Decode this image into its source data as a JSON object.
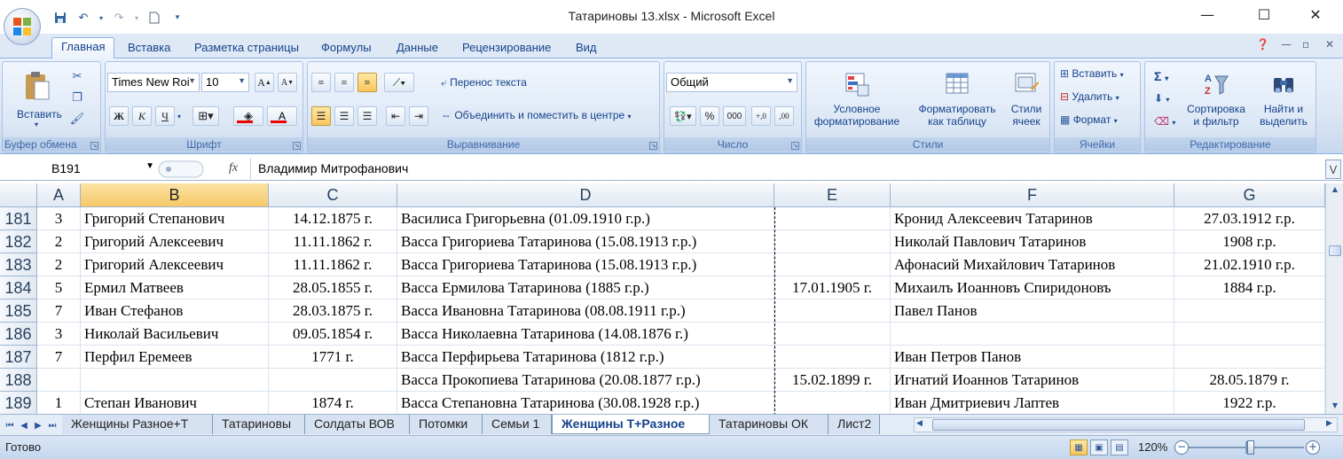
{
  "window": {
    "title": "Татариновы 13.xlsx - Microsoft Excel",
    "minimize_glyph": "—",
    "maximize_glyph": "☐",
    "close_glyph": "✕"
  },
  "ribbon_tabs": [
    "Главная",
    "Вставка",
    "Разметка страницы",
    "Формулы",
    "Данные",
    "Рецензирование",
    "Вид"
  ],
  "ribbon": {
    "clipboard": {
      "paste": "Вставить",
      "label": "Буфер обмена"
    },
    "font": {
      "name": "Times New Roi",
      "size": "10",
      "bold": "Ж",
      "italic": "К",
      "underline": "Ч",
      "label": "Шрифт"
    },
    "alignment": {
      "wrap": "Перенос текста",
      "merge": "Объединить и поместить в центре",
      "label": "Выравнивание"
    },
    "number": {
      "format": "Общий",
      "percent": "%",
      "thousands": "000",
      "label": "Число"
    },
    "styles": {
      "conditional": "Условное",
      "conditional2": "форматирование",
      "as_table": "Форматировать",
      "as_table2": "как таблицу",
      "cell_styles": "Стили",
      "cell_styles2": "ячеек",
      "label": "Стили"
    },
    "cells": {
      "insert": "Вставить",
      "delete": "Удалить",
      "format": "Формат",
      "label": "Ячейки"
    },
    "editing": {
      "sigma": "Σ",
      "sort": "Сортировка",
      "sort2": "и фильтр",
      "find": "Найти и",
      "find2": "выделить",
      "label": "Редактирование"
    }
  },
  "formula_bar": {
    "name_box": "B191",
    "fx": "fx",
    "value": "Владимир Митрофанович"
  },
  "columns": [
    "A",
    "B",
    "C",
    "D",
    "E",
    "F",
    "G"
  ],
  "selected_column": "B",
  "rows": [
    {
      "n": "181",
      "a": "3",
      "b": "Григорий Степанович",
      "c": "14.12.1875 г.",
      "d": "Василиса Григорьевна (01.09.1910 г.р.)",
      "e": "",
      "f": "Кронид Алексеевич Татаринов",
      "g": "27.03.1912 г.р."
    },
    {
      "n": "182",
      "a": "2",
      "b": "Григорий Алексеевич",
      "c": "11.11.1862 г.",
      "d": "Васса Григориева Татаринова (15.08.1913 г.р.)",
      "e": "",
      "f": "Николай Павлович Татаринов",
      "g": "1908 г.р."
    },
    {
      "n": "183",
      "a": "2",
      "b": "Григорий Алексеевич",
      "c": "11.11.1862 г.",
      "d": "Васса Григориева Татаринова (15.08.1913 г.р.)",
      "e": "",
      "f": "Афонасий Михайлович Татаринов",
      "g": "21.02.1910 г.р."
    },
    {
      "n": "184",
      "a": "5",
      "b": "Ермил Матвеев",
      "c": "28.05.1855 г.",
      "d": "Васса Ермилова Татаринова (1885 г.р.)",
      "e": "17.01.1905 г.",
      "f": "Михаилъ Иоанновъ Спиридоновъ",
      "g": "1884 г.р."
    },
    {
      "n": "185",
      "a": "7",
      "b": "Иван Стефанов",
      "c": "28.03.1875 г.",
      "d": "Васса Ивановна Татаринова (08.08.1911 г.р.)",
      "e": "",
      "f": "Павел Панов",
      "g": ""
    },
    {
      "n": "186",
      "a": "3",
      "b": "Николай Васильевич",
      "c": "09.05.1854 г.",
      "d": "Васса Николаевна Татаринова (14.08.1876 г.)",
      "e": "",
      "f": "",
      "g": ""
    },
    {
      "n": "187",
      "a": "7",
      "b": "Перфил Еремеев",
      "c": "1771 г.",
      "d": "Васса Перфирьева Татаринова (1812 г.р.)",
      "e": "",
      "f": "Иван Петров Панов",
      "g": ""
    },
    {
      "n": "188",
      "a": "",
      "b": "",
      "c": "",
      "d": "Васса Прокопиева Татаринова (20.08.1877 г.р.)",
      "e": "15.02.1899 г.",
      "f": "Игнатий Иоаннов Татаринов",
      "g": "28.05.1879 г."
    },
    {
      "n": "189",
      "a": "1",
      "b": "Степан Иванович",
      "c": "1874 г.",
      "d": "Васса Степановна Татаринова (30.08.1928 г.р.)",
      "e": "",
      "f": "Иван Дмитриевич Лаптев",
      "g": "1922 г.р."
    }
  ],
  "sheet_tabs": [
    "Женщины Разное+Т",
    "Татариновы",
    "Солдаты ВОВ",
    "Потомки",
    "Семьи 1",
    "Женщины Т+Разное",
    "Татариновы ОК",
    "Лист2"
  ],
  "active_sheet": "Женщины Т+Разное",
  "status": {
    "ready": "Готово",
    "zoom": "120%"
  },
  "colors": {
    "accent": "#2b579a",
    "selection": "#f6c867",
    "ribbon_bg": "#dbe6f4"
  }
}
